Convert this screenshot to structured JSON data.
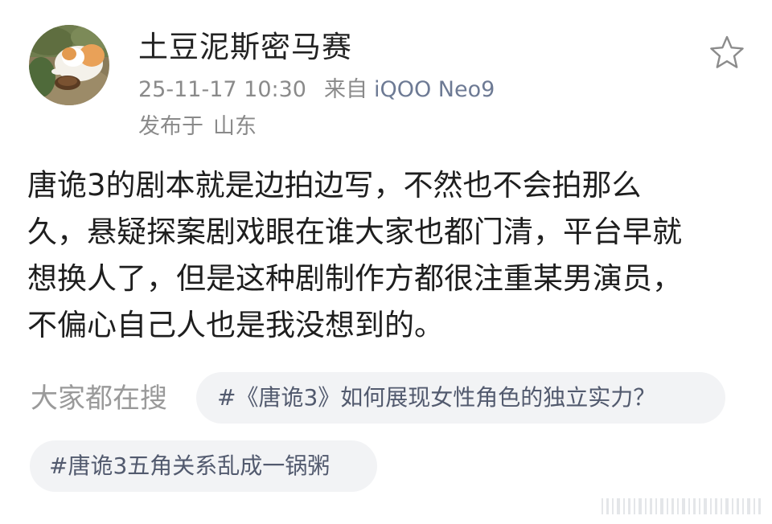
{
  "post": {
    "author": {
      "name": "土豆泥斯密马赛",
      "avatar_icon": "cat-photo-avatar"
    },
    "meta": {
      "time": "25-11-17 10:30",
      "from_label": "来自",
      "device": "iQOO Neo9"
    },
    "location": {
      "label": "发布于",
      "place": "山东"
    },
    "favorite_icon": "star-outline-icon",
    "content_lines": [
      "唐诡3的剧本就是边拍边写，不然也不会拍那么",
      "久，悬疑探案剧戏眼在谁大家也都门清，平台早就",
      "想换人了，但是这种剧制作方都很注重某男演员，",
      "不偏心自己人也是我没想到的。"
    ]
  },
  "searches": {
    "label": "大家都在搜",
    "topics": [
      "#《唐诡3》如何展现女性角色的独立实力？",
      "#唐诡3五角关系乱成一锅粥"
    ]
  },
  "colors": {
    "text": "#1e1e1e",
    "meta": "#8a8a8a",
    "chip_bg": "#f2f3f5",
    "chip_text": "#525a6e"
  }
}
